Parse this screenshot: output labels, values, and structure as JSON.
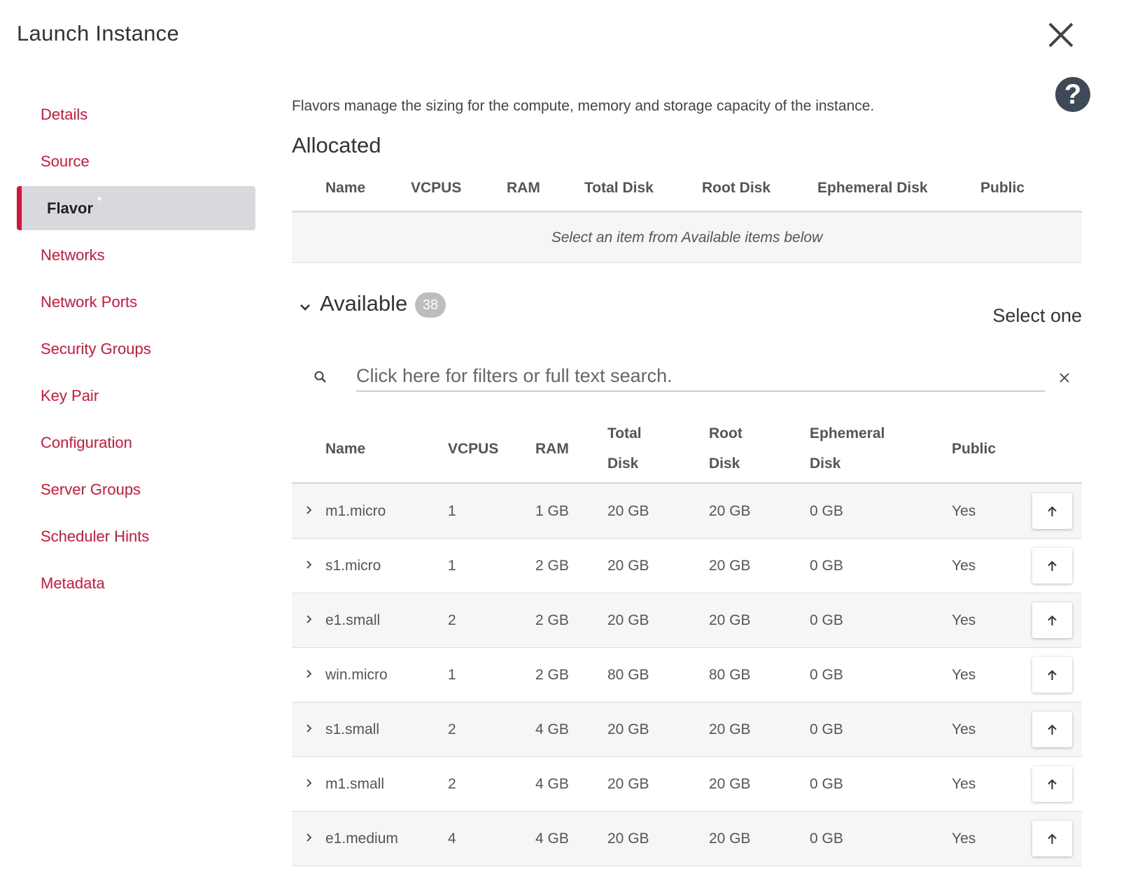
{
  "dialog": {
    "title": "Launch Instance",
    "help_glyph": "?"
  },
  "sidebar": {
    "items": [
      {
        "label": "Details",
        "name": "sidebar-item-details",
        "active": false
      },
      {
        "label": "Source",
        "name": "sidebar-item-source",
        "active": false
      },
      {
        "label": "Flavor",
        "name": "sidebar-item-flavor",
        "active": true,
        "required": "*"
      },
      {
        "label": "Networks",
        "name": "sidebar-item-networks",
        "active": false
      },
      {
        "label": "Network Ports",
        "name": "sidebar-item-network-ports",
        "active": false
      },
      {
        "label": "Security Groups",
        "name": "sidebar-item-security-groups",
        "active": false
      },
      {
        "label": "Key Pair",
        "name": "sidebar-item-key-pair",
        "active": false
      },
      {
        "label": "Configuration",
        "name": "sidebar-item-configuration",
        "active": false
      },
      {
        "label": "Server Groups",
        "name": "sidebar-item-server-groups",
        "active": false
      },
      {
        "label": "Scheduler Hints",
        "name": "sidebar-item-scheduler-hints",
        "active": false
      },
      {
        "label": "Metadata",
        "name": "sidebar-item-metadata",
        "active": false
      }
    ]
  },
  "main": {
    "description": "Flavors manage the sizing for the compute, memory and storage capacity of the instance.",
    "allocated": {
      "title": "Allocated",
      "columns": [
        "Name",
        "VCPUS",
        "RAM",
        "Total Disk",
        "Root Disk",
        "Ephemeral Disk",
        "Public"
      ],
      "empty_text": "Select an item from Available items below"
    },
    "available": {
      "title": "Available",
      "count": "38",
      "select_hint": "Select one",
      "search_placeholder": "Click here for filters or full text search.",
      "columns": [
        {
          "line1": "Name",
          "line2": ""
        },
        {
          "line1": "VCPUS",
          "line2": ""
        },
        {
          "line1": "RAM",
          "line2": ""
        },
        {
          "line1": "Total",
          "line2": "Disk"
        },
        {
          "line1": "Root",
          "line2": "Disk"
        },
        {
          "line1": "Ephemeral",
          "line2": "Disk"
        },
        {
          "line1": "Public",
          "line2": ""
        }
      ],
      "rows": [
        {
          "name": "m1.micro",
          "vcpus": "1",
          "ram": "1 GB",
          "total_disk": "20 GB",
          "root_disk": "20 GB",
          "ephemeral_disk": "0 GB",
          "public": "Yes"
        },
        {
          "name": "s1.micro",
          "vcpus": "1",
          "ram": "2 GB",
          "total_disk": "20 GB",
          "root_disk": "20 GB",
          "ephemeral_disk": "0 GB",
          "public": "Yes"
        },
        {
          "name": "e1.small",
          "vcpus": "2",
          "ram": "2 GB",
          "total_disk": "20 GB",
          "root_disk": "20 GB",
          "ephemeral_disk": "0 GB",
          "public": "Yes"
        },
        {
          "name": "win.micro",
          "vcpus": "1",
          "ram": "2 GB",
          "total_disk": "80 GB",
          "root_disk": "80 GB",
          "ephemeral_disk": "0 GB",
          "public": "Yes"
        },
        {
          "name": "s1.small",
          "vcpus": "2",
          "ram": "4 GB",
          "total_disk": "20 GB",
          "root_disk": "20 GB",
          "ephemeral_disk": "0 GB",
          "public": "Yes"
        },
        {
          "name": "m1.small",
          "vcpus": "2",
          "ram": "4 GB",
          "total_disk": "20 GB",
          "root_disk": "20 GB",
          "ephemeral_disk": "0 GB",
          "public": "Yes"
        },
        {
          "name": "e1.medium",
          "vcpus": "4",
          "ram": "4 GB",
          "total_disk": "20 GB",
          "root_disk": "20 GB",
          "ephemeral_disk": "0 GB",
          "public": "Yes"
        }
      ]
    }
  },
  "icons": {
    "close": "close-icon",
    "help": "help-icon",
    "collapse": "chevron-down-icon",
    "search": "search-icon",
    "clear": "clear-search-icon",
    "row_expand": "chevron-right-icon",
    "allocate": "arrow-up-icon"
  },
  "colors": {
    "accent": "#d0173b",
    "active_bg": "#d8d9dc",
    "help_bg": "#3e4a57",
    "badge_bg": "#bdbdbd"
  }
}
